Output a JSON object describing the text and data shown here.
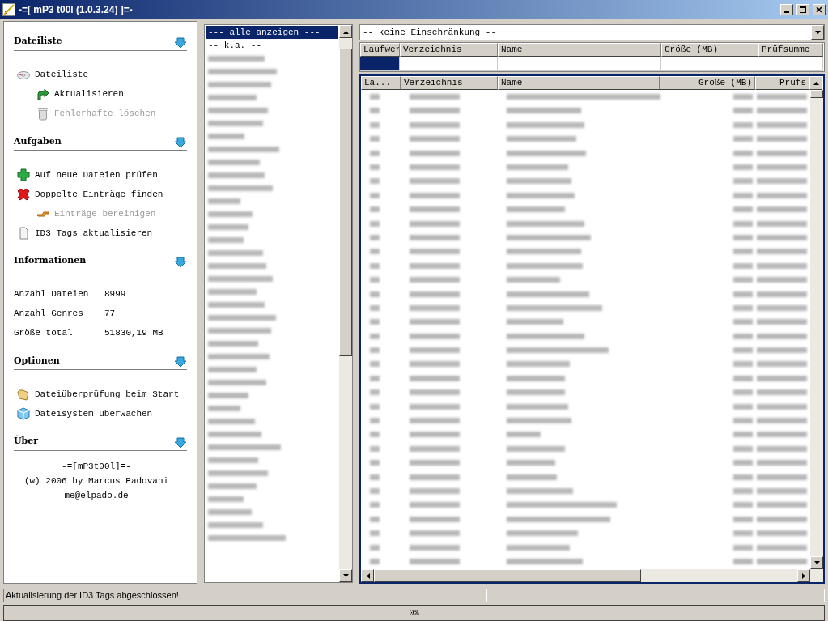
{
  "window": {
    "title": "-=[ mP3 t00l (1.0.3.24) ]=-"
  },
  "sidebar": {
    "sections": [
      {
        "title": "Dateiliste",
        "items": [
          {
            "label": "Dateiliste",
            "disabled": false,
            "children": [
              {
                "label": "Aktualisieren",
                "disabled": false
              },
              {
                "label": "Fehlerhafte löschen",
                "disabled": true
              }
            ]
          }
        ]
      },
      {
        "title": "Aufgaben",
        "items": [
          {
            "label": "Auf neue Dateien prüfen",
            "disabled": false
          },
          {
            "label": "Doppelte Einträge finden",
            "disabled": false,
            "children": [
              {
                "label": "Einträge bereinigen",
                "disabled": true
              }
            ]
          },
          {
            "label": "ID3 Tags aktualisieren",
            "disabled": false
          }
        ]
      },
      {
        "title": "Informationen",
        "info": [
          {
            "label": "Anzahl Dateien",
            "value": "8999"
          },
          {
            "label": "Anzahl Genres",
            "value": "77"
          },
          {
            "label": "Größe total",
            "value": "51830,19 MB"
          }
        ]
      },
      {
        "title": "Optionen",
        "items": [
          {
            "label": "Dateiüberprüfung beim Start",
            "disabled": false
          },
          {
            "label": "Dateisystem überwachen",
            "disabled": false
          }
        ]
      },
      {
        "title": "Über",
        "lines": [
          "-=[mP3t00l]=-",
          "(w) 2006 by Marcus Padovani",
          "me@elpado.de"
        ]
      }
    ]
  },
  "genre_list": {
    "items": [
      {
        "text": "--- alle anzeigen ---",
        "selected": true
      },
      {
        "text": "-- k.a. --",
        "selected": false
      }
    ]
  },
  "filter": {
    "value": "-- keine Einschränkung --",
    "columns": [
      "Laufwer",
      "Verzeichnis",
      "Name",
      "Größe (MB)",
      "Prüfsumme"
    ]
  },
  "table": {
    "columns": [
      "La...",
      "Verzeichnis",
      "Name",
      "Größe (MB)",
      "Prüfs"
    ]
  },
  "status_bar": {
    "message": "Aktualisierung der ID3 Tags abgeschlossen!",
    "progress": {
      "level": 0,
      "reading": "0%"
    }
  }
}
